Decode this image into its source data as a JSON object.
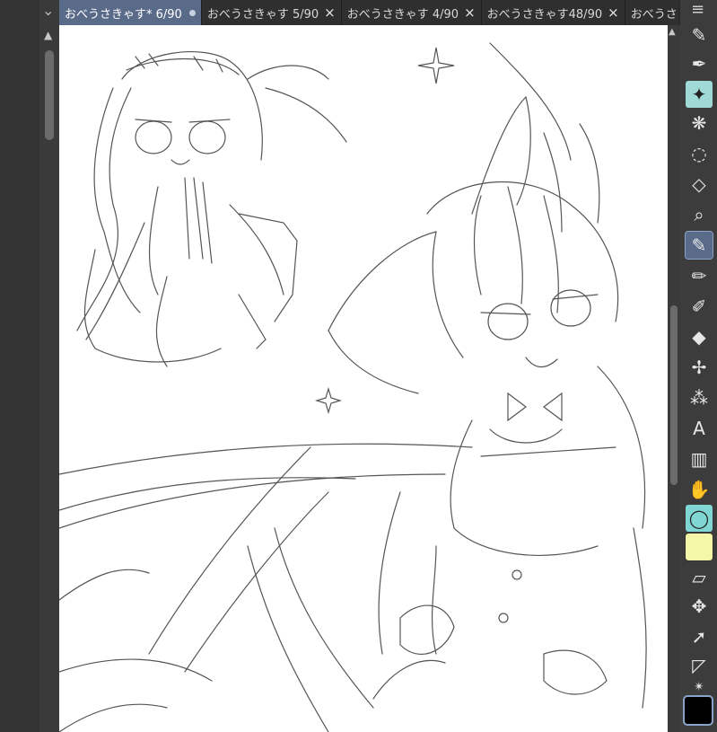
{
  "tabs": [
    {
      "label": "おべうさきゃす* 6/90",
      "active": true
    },
    {
      "label": "おべうさきゃす 5/90",
      "active": false
    },
    {
      "label": "おべうさきゃす 4/90",
      "active": false
    },
    {
      "label": "おべうさきゃす48/90",
      "active": false
    },
    {
      "label": "おべうさきゃす37/90",
      "active": false
    },
    {
      "label": "お",
      "active": false
    }
  ],
  "icons": {
    "tab_close": "×",
    "panel_chevron": "⌄",
    "scroll_up": "▲",
    "menu": "≡"
  },
  "colors": {
    "active_tab": "#5a6b8a",
    "canvas": "#ffffff",
    "current_color": "#000000"
  }
}
